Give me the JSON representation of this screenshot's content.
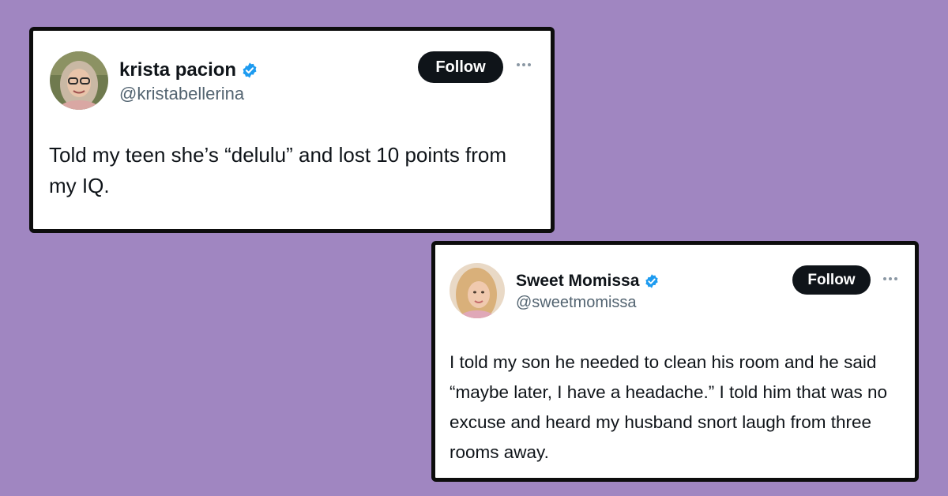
{
  "colors": {
    "background": "#a086c1",
    "card": "#ffffff",
    "card_border": "#0d0d0d",
    "follow_button": "#0f1419",
    "verified_badge": "#1d9bf0",
    "handle_text": "#536471"
  },
  "tweets": [
    {
      "display_name": "krista pacion",
      "handle": "@kristabellerina",
      "verified": true,
      "follow_label": "Follow",
      "more_icon": "more-horizontal-icon",
      "text": "Told my teen she’s “delulu” and lost 10 points from my IQ."
    },
    {
      "display_name": "Sweet Momissa",
      "handle": "@sweetmomissa",
      "verified": true,
      "follow_label": "Follow",
      "more_icon": "more-horizontal-icon",
      "text": "I told my son he needed to clean his room and he said “maybe later, I have a headache.” I told him that was no excuse and heard my husband snort laugh from three rooms away."
    }
  ]
}
